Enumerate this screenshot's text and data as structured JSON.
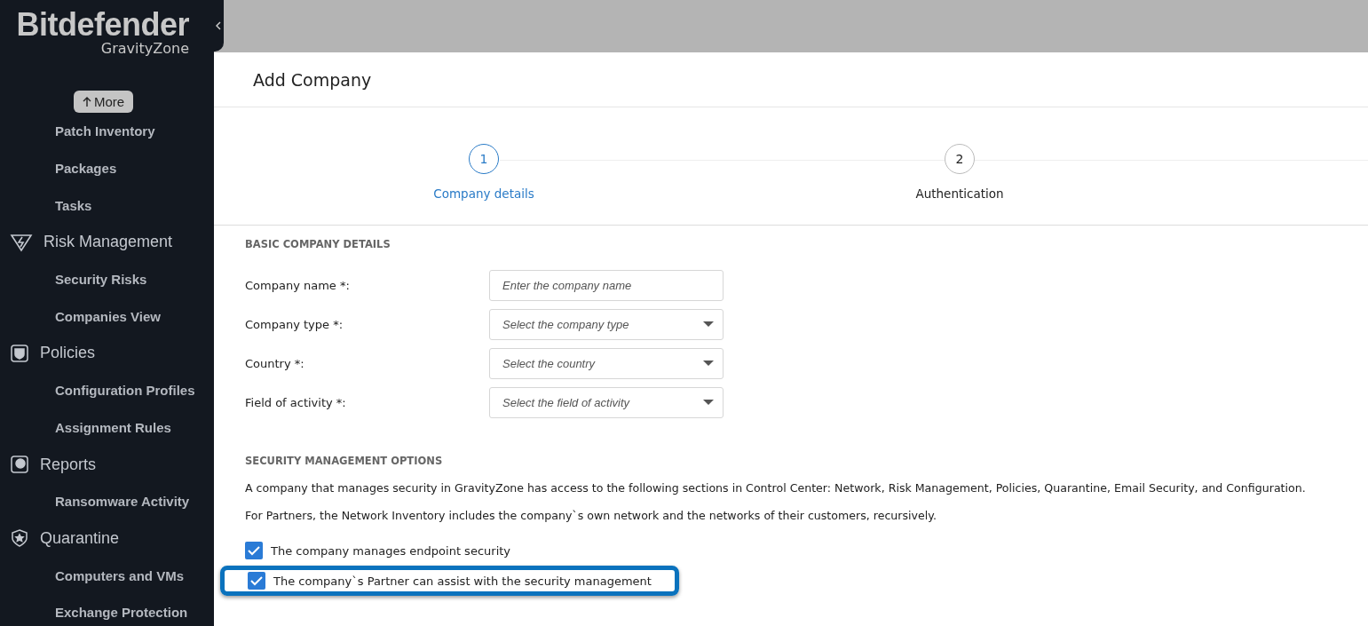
{
  "brand": {
    "name": "Bitdefender",
    "product": "GravityZone"
  },
  "more_button": "More",
  "sidebar": {
    "items": [
      {
        "label": "Patch Inventory",
        "kind": "sub"
      },
      {
        "label": "Packages",
        "kind": "sub"
      },
      {
        "label": "Tasks",
        "kind": "sub"
      },
      {
        "label": "Risk Management",
        "kind": "section"
      },
      {
        "label": "Security Risks",
        "kind": "sub"
      },
      {
        "label": "Companies View",
        "kind": "sub"
      },
      {
        "label": "Policies",
        "kind": "section"
      },
      {
        "label": "Configuration Profiles",
        "kind": "sub"
      },
      {
        "label": "Assignment Rules",
        "kind": "sub"
      },
      {
        "label": "Reports",
        "kind": "section"
      },
      {
        "label": "Ransomware Activity",
        "kind": "sub"
      },
      {
        "label": "Quarantine",
        "kind": "section"
      },
      {
        "label": "Computers and VMs",
        "kind": "sub"
      },
      {
        "label": "Exchange Protection",
        "kind": "sub"
      }
    ]
  },
  "page_title": "Add Company",
  "steps": [
    {
      "number": "1",
      "label": "Company details",
      "selected": true
    },
    {
      "number": "2",
      "label": "Authentication",
      "selected": false
    }
  ],
  "basic_section": {
    "title": "BASIC COMPANY DETAILS",
    "fields": [
      {
        "label": "Company name *:",
        "placeholder": "Enter the company name",
        "kind": "text"
      },
      {
        "label": "Company type *:",
        "placeholder": "Select the company type",
        "kind": "select"
      },
      {
        "label": "Country *:",
        "placeholder": "Select the country",
        "kind": "select"
      },
      {
        "label": "Field of activity *:",
        "placeholder": "Select the field of activity",
        "kind": "select"
      }
    ]
  },
  "security_section": {
    "title": "SECURITY MANAGEMENT OPTIONS",
    "paragraphs": [
      "A company that manages security in GravityZone has access to the following sections in Control Center: Network, Risk Management, Policies, Quarantine, Email Security, and Configuration.",
      "For Partners, the Network Inventory includes the company`s own network and the networks of their customers, recursively."
    ],
    "options": [
      {
        "label": "The company manages endpoint security",
        "checked": true,
        "highlighted": false
      },
      {
        "label": "The company`s Partner can assist with the security management",
        "checked": true,
        "highlighted": true
      }
    ]
  }
}
